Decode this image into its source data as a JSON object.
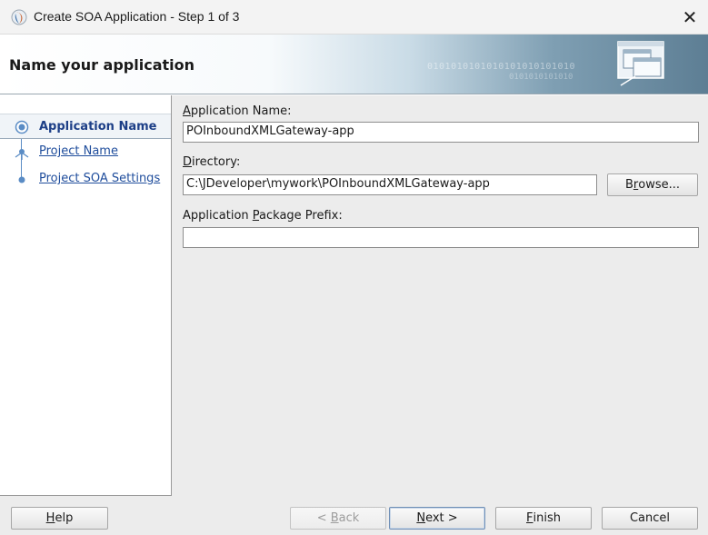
{
  "window": {
    "title": "Create SOA Application - Step 1 of 3",
    "icon": "jdeveloper-icon",
    "close_glyph": "✕"
  },
  "header": {
    "title": "Name your application",
    "decor_binary_1": "0101010101010101010101010",
    "decor_binary_2": "0101010101010"
  },
  "nav": {
    "items": [
      {
        "label": "Application Name",
        "state": "current"
      },
      {
        "label": "Project Name",
        "state": "link"
      },
      {
        "label": "Project SOA Settings",
        "state": "link"
      }
    ]
  },
  "form": {
    "app_name_label_mnemonic": "A",
    "app_name_label_rest": "pplication Name:",
    "app_name_value": "POInboundXMLGateway-app",
    "directory_label_mnemonic": "D",
    "directory_label_rest": "irectory:",
    "directory_value": "C:\\JDeveloper\\mywork\\POInboundXMLGateway-app",
    "browse_mnemonic": "r",
    "browse_pre": "B",
    "browse_post": "owse...",
    "prefix_label_pre": "Application ",
    "prefix_label_mnemonic": "P",
    "prefix_label_rest": "ackage Prefix:",
    "prefix_value": ""
  },
  "buttons": {
    "help_mnemonic": "H",
    "help_rest": "elp",
    "back_pre": "< ",
    "back_mnemonic": "B",
    "back_rest": "ack",
    "next_mnemonic": "N",
    "next_rest": "ext >",
    "finish_mnemonic": "F",
    "finish_rest": "inish",
    "cancel_label": "Cancel"
  },
  "colors": {
    "accent": "#1d3f87",
    "link": "#1f4d9c",
    "nav_line": "#5a8cc5"
  }
}
